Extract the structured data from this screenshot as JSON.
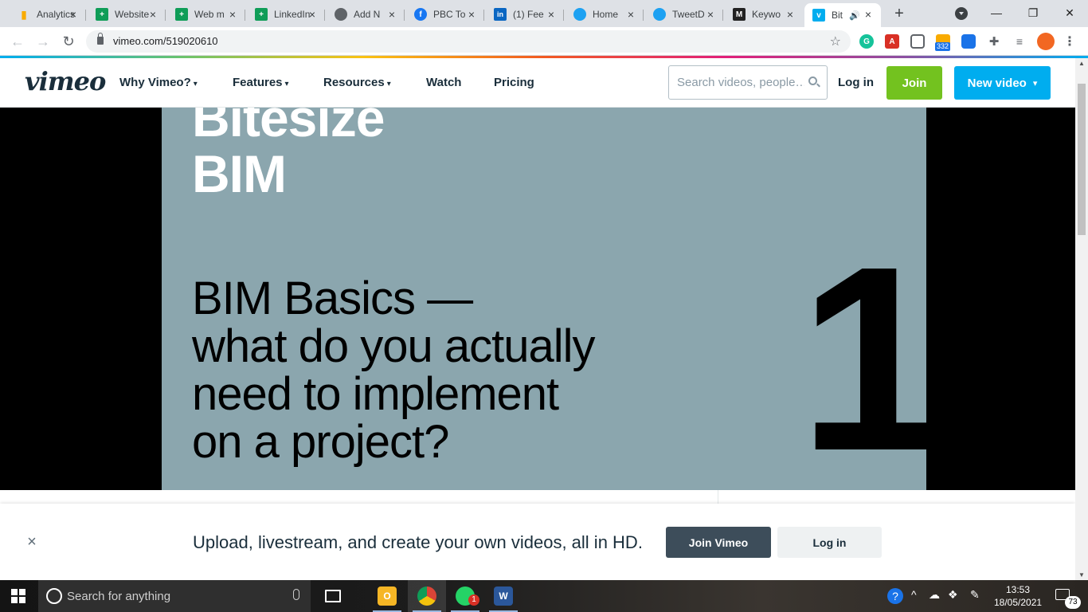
{
  "browser": {
    "tabs": [
      {
        "title": "Analytics",
        "color": "#f9ab00",
        "glyph": "▮"
      },
      {
        "title": "Website",
        "color": "#0f9d58",
        "glyph": "+"
      },
      {
        "title": "Web m",
        "color": "#0f9d58",
        "glyph": "+"
      },
      {
        "title": "LinkedIn",
        "color": "#0f9d58",
        "glyph": "+"
      },
      {
        "title": "Add N",
        "color": "#5f6368",
        "glyph": "◍"
      },
      {
        "title": "PBC To",
        "color": "#1877f2",
        "glyph": "f"
      },
      {
        "title": "(1) Fee",
        "color": "#0a66c2",
        "glyph": "in"
      },
      {
        "title": "Home",
        "color": "#1da1f2",
        "glyph": "🐦"
      },
      {
        "title": "TweetD",
        "color": "#1da1f2",
        "glyph": "🐦"
      },
      {
        "title": "Keywo",
        "color": "#222222",
        "glyph": "M"
      },
      {
        "title": "Bit",
        "color": "#00adef",
        "glyph": "v",
        "active": true
      }
    ],
    "new_tab": "+",
    "window": {
      "minimize": "—",
      "restore": "❐",
      "close": "✕"
    },
    "url": "vimeo.com/519020610",
    "extension_badge": "332"
  },
  "vimeo": {
    "logo": "vimeo",
    "nav": [
      {
        "label": "Why Vimeo?",
        "has_menu": true
      },
      {
        "label": "Features",
        "has_menu": true
      },
      {
        "label": "Resources",
        "has_menu": true
      },
      {
        "label": "Watch",
        "has_menu": false
      },
      {
        "label": "Pricing",
        "has_menu": false
      }
    ],
    "search_placeholder": "Search videos, people…",
    "login_label": "Log in",
    "join_label": "Join",
    "new_video_label": "New video"
  },
  "video": {
    "title_line1": "Bitesize",
    "title_line2": "BIM",
    "subtitle_line1": "BIM Basics —",
    "subtitle_line2": "what do you actually",
    "subtitle_line3": "need to implement",
    "subtitle_line4": "on a project?",
    "episode_number": "1"
  },
  "banner": {
    "close": "×",
    "text": "Upload, livestream, and create your own videos, all in HD.",
    "join_label": "Join Vimeo",
    "login_label": "Log in"
  },
  "taskbar": {
    "search_placeholder": "Search for anything",
    "time": "13:53",
    "date": "18/05/2021",
    "notifications": "73",
    "whatsapp_badge": "1"
  }
}
